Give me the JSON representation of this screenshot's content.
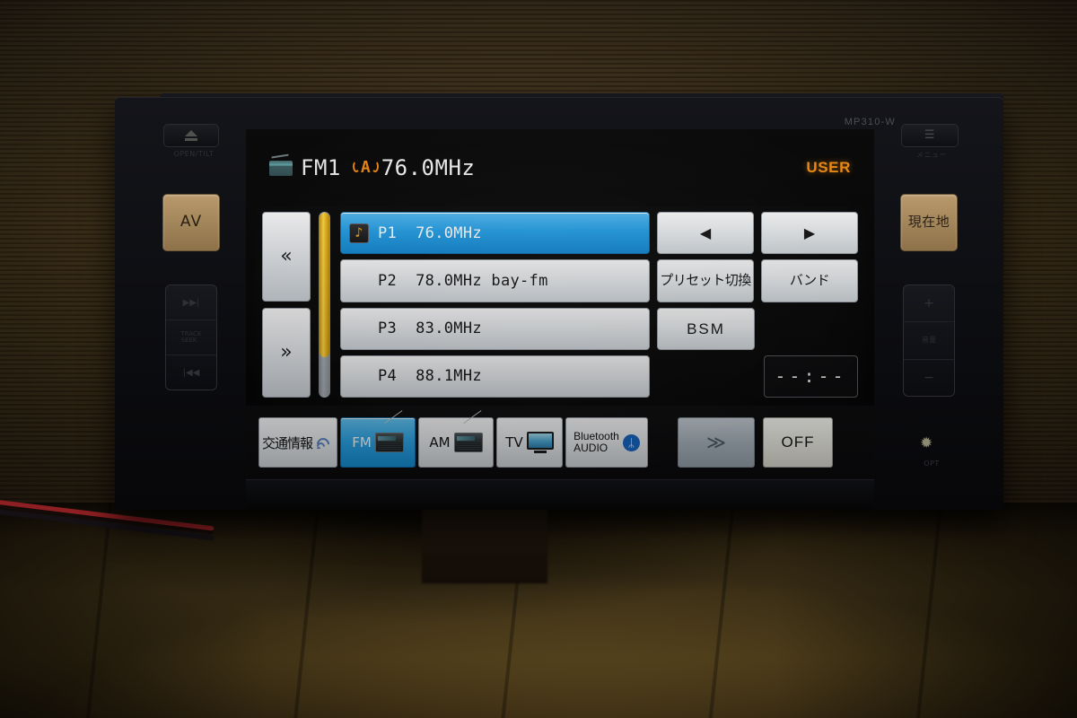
{
  "device": {
    "model_label": "MP310-W"
  },
  "hardware": {
    "left": {
      "eject_label": "OPEN/TILT",
      "av_label": "AV",
      "track_next": "▶▶|",
      "track_mid_label": "TRACK\nSEEK",
      "track_prev": "|◀◀"
    },
    "right": {
      "menu_label": "メニュー",
      "current_location_label": "現在地",
      "volume_up": "+",
      "volume_mid_label": "音量",
      "volume_down": "−",
      "opt_icon": "✹",
      "opt_label": "OPT"
    }
  },
  "screen": {
    "header": {
      "radio_icon": "radio-icon",
      "band": "FM1",
      "antenna_icon": "A",
      "frequency": "76.0MHz",
      "user_badge": "USER"
    },
    "scroll": {
      "up_icon": "«",
      "down_icon": "»",
      "thumb_percent": 78
    },
    "presets": [
      {
        "label": "P1  76.0MHz",
        "selected": true,
        "has_note_icon": true
      },
      {
        "label": "P2  78.0MHz bay-fm",
        "selected": false,
        "has_note_icon": false
      },
      {
        "label": "P3  83.0MHz",
        "selected": false,
        "has_note_icon": false
      },
      {
        "label": "P4  88.1MHz",
        "selected": false,
        "has_note_icon": false
      }
    ],
    "note_icon_glyph": "♪",
    "controls": {
      "seek_prev": "◀",
      "seek_next": "▶",
      "preset_switch": "プリセット切換",
      "band": "バンド",
      "bsm": "BSM",
      "clock": "--:--"
    },
    "tabs": [
      {
        "label": "交通情報",
        "icon": "traffic-wifi-icon",
        "active": false
      },
      {
        "label": "FM",
        "icon": "radio-icon",
        "active": true
      },
      {
        "label": "AM",
        "icon": "radio-icon",
        "active": false
      },
      {
        "label": "TV",
        "icon": "tv-icon",
        "active": false
      },
      {
        "label": "Bluetooth\nAUDIO",
        "icon": "bluetooth-icon",
        "active": false
      }
    ],
    "tab_next_icon": "≫",
    "tab_off_label": "OFF"
  },
  "colors": {
    "accent_blue": "#1f9de6",
    "user_orange": "#ef8a10",
    "antenna_orange": "#e8820f",
    "scrollbar_yellow": "#f2bb16",
    "amber_button": "#b99a6d"
  }
}
